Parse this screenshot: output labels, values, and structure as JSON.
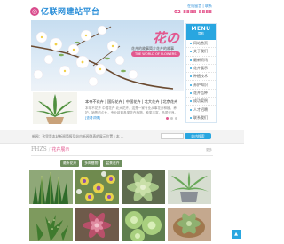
{
  "header": {
    "logo_mark": "◎",
    "logo_text": "亿联网建站平台",
    "contact_links": "在线留言 | 联系",
    "phone": "02-8888-8888"
  },
  "banner": {
    "title": "花の",
    "subtitle": "花卉的故事简介花卉的故事",
    "pill_text": "THE WORLD OF FLOWERS"
  },
  "menu": {
    "title": "MENU",
    "subtitle": "导航",
    "items": [
      "网站首页",
      "关于我们",
      "最新资讯",
      "花卉展示",
      "种植技术",
      "养护知识",
      "花卉品种",
      "成功案例",
      "人才招聘",
      "联系我们"
    ]
  },
  "intro": {
    "title": "本帝不花卉 | 国际花卉 | 中国花卉 | 北大花卉 | 北京花卉",
    "text": "本帝不花卉 中国花卉 北大花卉，这是一家专业从事花卉种植，养护，销售的企业，专业培育各类花卉植物，种类丰富，品质优良。",
    "more": "[查看详情]"
  },
  "search": {
    "news_label": "新闻：这里是本站新闻简报及站内新闻列表的展示位置 | 本 ...",
    "placeholder": "",
    "button": "站内搜索"
  },
  "section": {
    "title_en": "FHZS",
    "separator": "/",
    "title_cn": "花卉展示",
    "more": "更多"
  },
  "tabs": [
    "最新花卉",
    "多肉植物",
    "盆景花卉"
  ],
  "plants": [
    {
      "name": "sansevieria",
      "bg": "#8aa070",
      "fg": "#2f6b2a"
    },
    {
      "name": "pansies",
      "bg": "#c8c080",
      "fg": "#9b59b6"
    },
    {
      "name": "succulent-rosette",
      "bg": "#6f7d5e",
      "fg": "#9fbf80"
    },
    {
      "name": "aloe-pot",
      "bg": "#cfd8c0",
      "fg": "#5f9f4f"
    },
    {
      "name": "haworthia",
      "bg": "#6f8f4e",
      "fg": "#3f7a2e"
    },
    {
      "name": "echeveria-red",
      "bg": "#7f6a58",
      "fg": "#c0506a"
    },
    {
      "name": "cactus-green",
      "bg": "#6a8a5a",
      "fg": "#a8d080"
    },
    {
      "name": "succulent-pot",
      "bg": "#b89a80",
      "fg": "#8fb070"
    }
  ],
  "colors": {
    "accent_blue": "#29a6e0",
    "accent_pink": "#e2588f",
    "tab_green": "#6e8f5e"
  },
  "back_to_top": "▲"
}
